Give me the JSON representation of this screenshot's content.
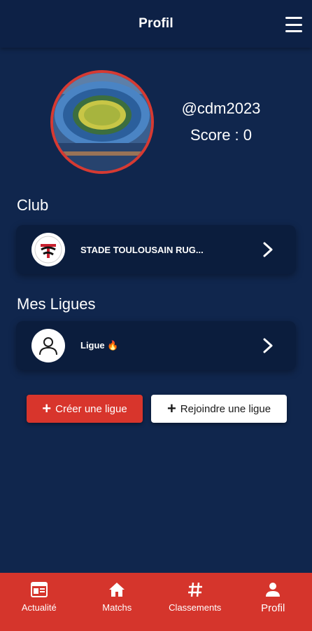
{
  "header": {
    "title": "Profil"
  },
  "profile": {
    "username": "@cdm2023",
    "score_label": "Score : ",
    "score_value": "0"
  },
  "club": {
    "section_title": "Club",
    "name": "STADE TOULOUSAIN RUG..."
  },
  "leagues": {
    "section_title": "Mes Ligues",
    "items": [
      {
        "label": "Ligue 🔥"
      }
    ]
  },
  "actions": {
    "create_label": "Créer une ligue",
    "join_label": "Rejoindre une ligue"
  },
  "bottom_nav": {
    "items": [
      {
        "label": "Actualité",
        "icon": "news-icon"
      },
      {
        "label": "Matchs",
        "icon": "home-icon"
      },
      {
        "label": "Classements",
        "icon": "hash-icon"
      },
      {
        "label": "Profil",
        "icon": "user-icon",
        "active": true
      }
    ]
  },
  "colors": {
    "background": "#10264d",
    "card": "#0b1d3d",
    "accent_red": "#d5352c"
  }
}
